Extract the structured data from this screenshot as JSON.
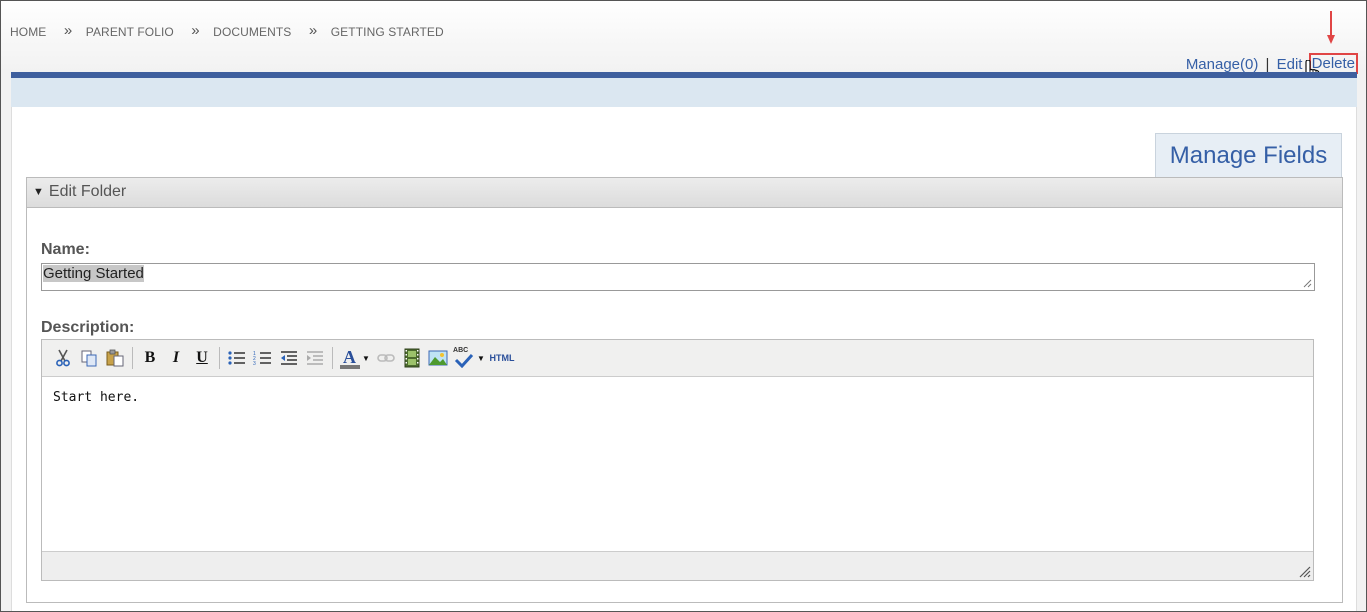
{
  "breadcrumb": {
    "items": [
      "HOME",
      "PARENT FOLIO",
      "DOCUMENTS",
      "GETTING STARTED"
    ],
    "separator": "»"
  },
  "actions": {
    "manage": "Manage(0)",
    "separator": "|",
    "edit": "Edit",
    "delete": "Delete",
    "highlight_color": "#e04545"
  },
  "tabs": {
    "manage_fields": "Manage Fields"
  },
  "panel": {
    "title": "Edit Folder",
    "name_label": "Name:",
    "name_value": "Getting Started",
    "description_label": "Description:",
    "description_value": "Start here."
  },
  "toolbar": {
    "buttons": [
      "cut-icon",
      "copy-icon",
      "paste-icon",
      "bold-icon",
      "italic-icon",
      "underline-icon",
      "bullet-list-icon",
      "numbered-list-icon",
      "outdent-icon",
      "indent-icon",
      "font-color-icon",
      "link-icon",
      "media-icon",
      "image-icon",
      "spellcheck-icon",
      "html-icon"
    ],
    "bold": "B",
    "italic": "I",
    "underline": "U",
    "font_color": "A",
    "spellcheck": "ABC",
    "html": "HTML"
  },
  "colors": {
    "accent": "#355fa6",
    "header_bar": "#3e5f9e",
    "subheader": "#dbe7f1"
  }
}
